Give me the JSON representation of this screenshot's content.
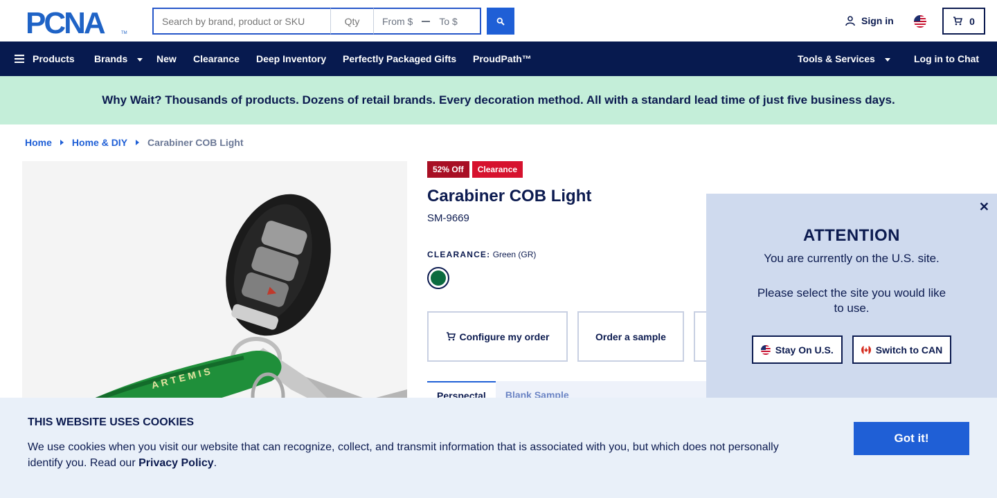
{
  "header": {
    "search_placeholder": "Search by brand, product or SKU",
    "qty_placeholder": "Qty",
    "price_from": "From $",
    "price_to": "To $",
    "sign_in": "Sign in",
    "cart_count": "0",
    "logo_text": "PCNA"
  },
  "nav": {
    "products": "Products",
    "brands": "Brands",
    "new": "New",
    "clearance": "Clearance",
    "deep_inventory": "Deep Inventory",
    "gifts": "Perfectly Packaged Gifts",
    "proudpath": "ProudPath™",
    "tools": "Tools & Services",
    "chat": "Log in to Chat"
  },
  "promo": "Why Wait? Thousands of products. Dozens of retail brands. Every decoration method. All with a standard lead time of just five business days.",
  "breadcrumb": {
    "home": "Home",
    "category": "Home & DIY",
    "current": "Carabiner COB Light"
  },
  "product": {
    "badge_discount": "52% Off",
    "badge_clearance": "Clearance",
    "title": "Carabiner COB Light",
    "sku": "SM-9669",
    "clearance_label": "CLEARANCE:",
    "color_value": "Green (GR)",
    "image_text": "ARTEMIS"
  },
  "actions": {
    "configure": "Configure my order",
    "sample": "Order a sample"
  },
  "tabs": {
    "active": "Perspectal",
    "inactive": "Blank Sample"
  },
  "attention": {
    "title": "ATTENTION",
    "message": "You are currently on the U.S. site.",
    "message2": "Please select the site you would like to use.",
    "stay": "Stay On U.S.",
    "switch": "Switch to CAN"
  },
  "cookie": {
    "title": "THIS WEBSITE USES COOKIES",
    "text": "We use cookies when you visit our website that can recognize, collect, and transmit information that is associated with you, but which does not personally identify you. Read our",
    "privacy": "Privacy Policy",
    "period": ".",
    "accept": "Got it!"
  },
  "colors": {
    "navy": "#071a4f",
    "brand_blue": "#1f5fd6",
    "promo_green": "#c4eed9",
    "badge_red": "#d6122e",
    "swatch_green": "#0b6b3f"
  }
}
